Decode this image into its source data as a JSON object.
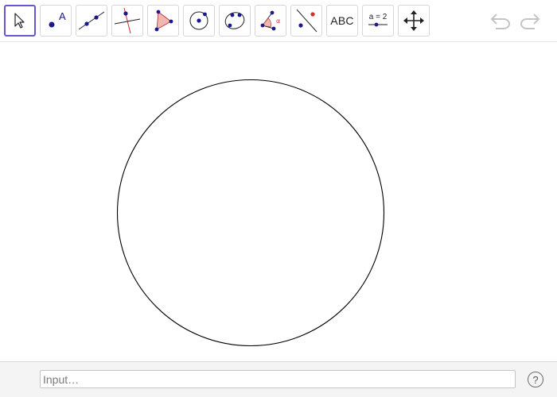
{
  "toolbar": {
    "tools": [
      {
        "name": "move-tool",
        "icon": "cursor-arrow-icon",
        "active": true
      },
      {
        "name": "point-tool",
        "icon": "point-icon",
        "label": "A"
      },
      {
        "name": "line-tool",
        "icon": "line-through-two-points-icon"
      },
      {
        "name": "perpendicular-line-tool",
        "icon": "perpendicular-line-icon"
      },
      {
        "name": "polygon-tool",
        "icon": "polygon-icon"
      },
      {
        "name": "circle-tool",
        "icon": "circle-center-point-icon"
      },
      {
        "name": "conic-tool",
        "icon": "ellipse-icon"
      },
      {
        "name": "angle-tool",
        "icon": "angle-icon",
        "label": "α"
      },
      {
        "name": "reflect-tool",
        "icon": "reflect-about-line-icon"
      },
      {
        "name": "text-tool",
        "icon": "text-icon",
        "label": "ABC"
      },
      {
        "name": "slider-tool",
        "icon": "slider-icon",
        "label": "a = 2"
      },
      {
        "name": "move-graphics-view-tool",
        "icon": "move-arrows-icon"
      }
    ],
    "undo_icon": "undo-icon",
    "redo_icon": "redo-icon"
  },
  "graphics": {
    "objects": [
      {
        "type": "circle",
        "color": "#000000"
      }
    ]
  },
  "input_bar": {
    "placeholder": "Input…",
    "value": "",
    "help_label": "?"
  },
  "colors": {
    "accent": "#6557d2",
    "point_blue": "#1a1a8c",
    "highlight_red": "#d32f2f",
    "polygon_fill": "#f2b6b0"
  }
}
